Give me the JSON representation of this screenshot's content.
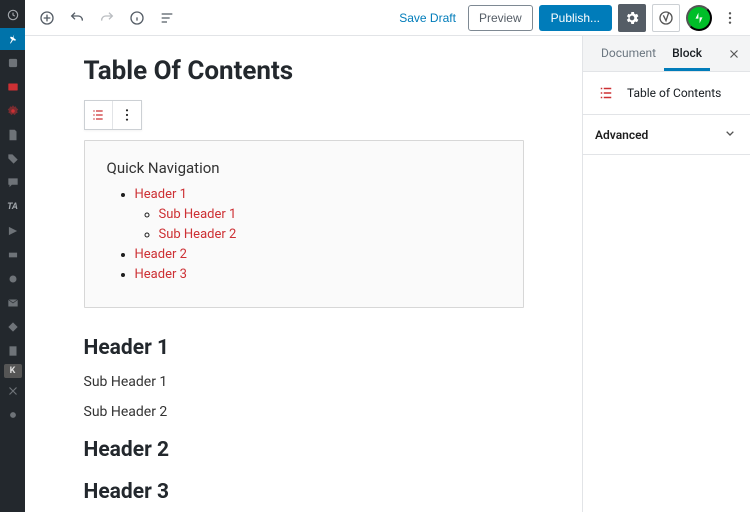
{
  "toolbar": {
    "save_draft": "Save Draft",
    "preview": "Preview",
    "publish": "Publish..."
  },
  "editor": {
    "title": "Table Of Contents",
    "toc": {
      "heading": "Quick Navigation",
      "items": [
        {
          "label": "Header 1",
          "children": [
            {
              "label": "Sub Header 1"
            },
            {
              "label": "Sub Header 2"
            }
          ]
        },
        {
          "label": "Header 2"
        },
        {
          "label": "Header 3"
        }
      ]
    },
    "content_headers": {
      "h1": "Header 1",
      "s1": "Sub Header 1",
      "s2": "Sub Header 2",
      "h2": "Header 2",
      "h3": "Header 3"
    }
  },
  "sidebar": {
    "tabs": {
      "document": "Document",
      "block": "Block"
    },
    "block_name": "Table of Contents",
    "advanced": "Advanced"
  }
}
